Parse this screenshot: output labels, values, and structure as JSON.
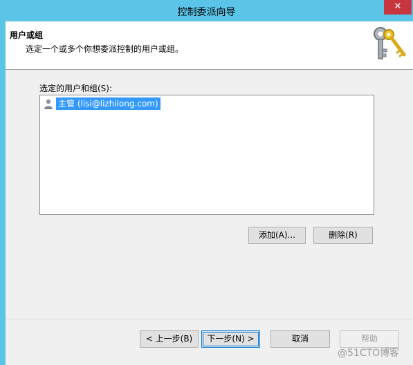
{
  "window": {
    "title": "控制委派向导",
    "close_glyph": "✕"
  },
  "header": {
    "title": "用户或组",
    "subtitle": "选定一个或多个你想委派控制的用户或组。",
    "icon": "keys-icon"
  },
  "list": {
    "label": "选定的用户和组(S):",
    "items": [
      {
        "icon": "user-icon",
        "text": "主管 (lisi@lizhilong.com)",
        "selected": true
      }
    ]
  },
  "buttons": {
    "add": "添加(A)...",
    "delete": "删除(R)"
  },
  "footer": {
    "back": "< 上一步(B)",
    "next": "下一步(N) >",
    "cancel": "取消",
    "help": "帮助"
  },
  "watermark": "@51CTO博客",
  "colors": {
    "titlebar": "#5bc5e8",
    "close": "#c7363e",
    "selection": "#3399ff"
  }
}
